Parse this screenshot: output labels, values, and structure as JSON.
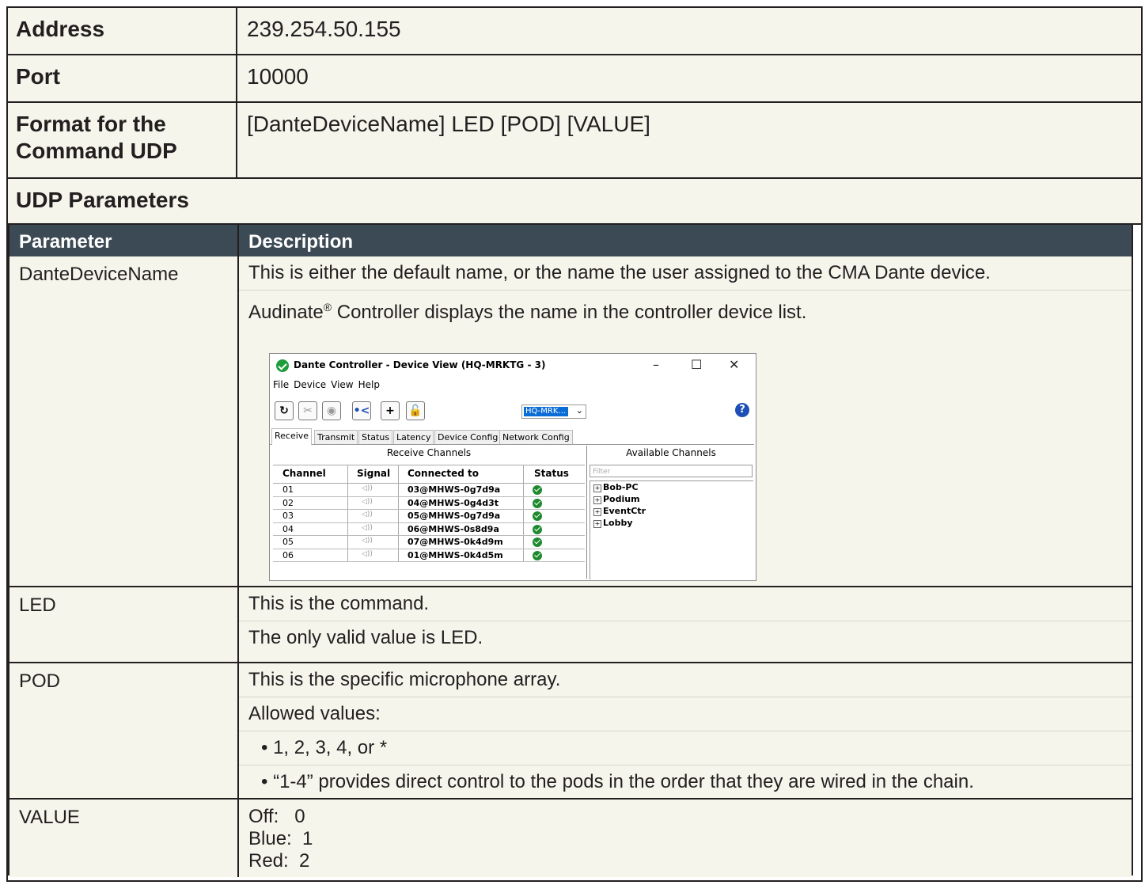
{
  "rows": [
    {
      "label": "Address",
      "value": "239.254.50.155"
    },
    {
      "label": "Port",
      "value": "10000"
    },
    {
      "label_line1": "Format for the",
      "label_line2": "Command UDP",
      "value": "[DanteDeviceName] LED [POD] [VALUE]"
    }
  ],
  "udp_title": "UDP Parameters",
  "param_table": {
    "headers": [
      "Parameter",
      "Description"
    ],
    "dante": {
      "name": "DanteDeviceName",
      "line1": "This is either the default name, or the name the user assigned to the CMA Dante device.",
      "line2_prefix": "Audinate",
      "line2_reg": "®",
      "line2_suffix": " Controller displays the name in the controller device list."
    },
    "led": {
      "name": "LED",
      "line1": "This is the command.",
      "line2": "The only valid value is LED."
    },
    "pod": {
      "name": "POD",
      "line1": "This is the specific microphone array.",
      "line2": "Allowed values:",
      "bullet1": "• 1, 2, 3, 4, or *",
      "bullet2": "• “1-4” provides direct control to the pods in the order that they are wired in the chain."
    },
    "value": {
      "name": "VALUE",
      "v1": "Off:   0",
      "v2": "Blue:  1",
      "v3": "Red:  2"
    }
  },
  "screenshot": {
    "title": "Dante Controller - Device View (HQ-MRKTG - 3)",
    "window_buttons": [
      "–",
      "☐",
      "✕"
    ],
    "menu": [
      "File",
      "Device",
      "View",
      "Help"
    ],
    "device_dropdown": "HQ-MRK...",
    "help_glyph": "?",
    "tabs": [
      "Receive",
      "Transmit",
      "Status",
      "Latency",
      "Device Config",
      "Network Config"
    ],
    "receive_title": "Receive Channels",
    "available_title": "Available Channels",
    "filter_placeholder": "Filter",
    "columns": [
      "Channel",
      "Signal",
      "Connected to",
      "Status"
    ],
    "channels": [
      {
        "ch": "01",
        "conn": "03@MHWS-0g7d9a"
      },
      {
        "ch": "02",
        "conn": "04@MHWS-0g4d3t"
      },
      {
        "ch": "03",
        "conn": "05@MHWS-0g7d9a"
      },
      {
        "ch": "04",
        "conn": "06@MHWS-0s8d9a"
      },
      {
        "ch": "05",
        "conn": "07@MHWS-0k4d9m"
      },
      {
        "ch": "06",
        "conn": "01@MHWS-0k4d5m"
      }
    ],
    "signal_glyph": "◁))",
    "available": [
      "Bob-PC",
      "Podium",
      "EventCtr",
      "Lobby"
    ]
  }
}
